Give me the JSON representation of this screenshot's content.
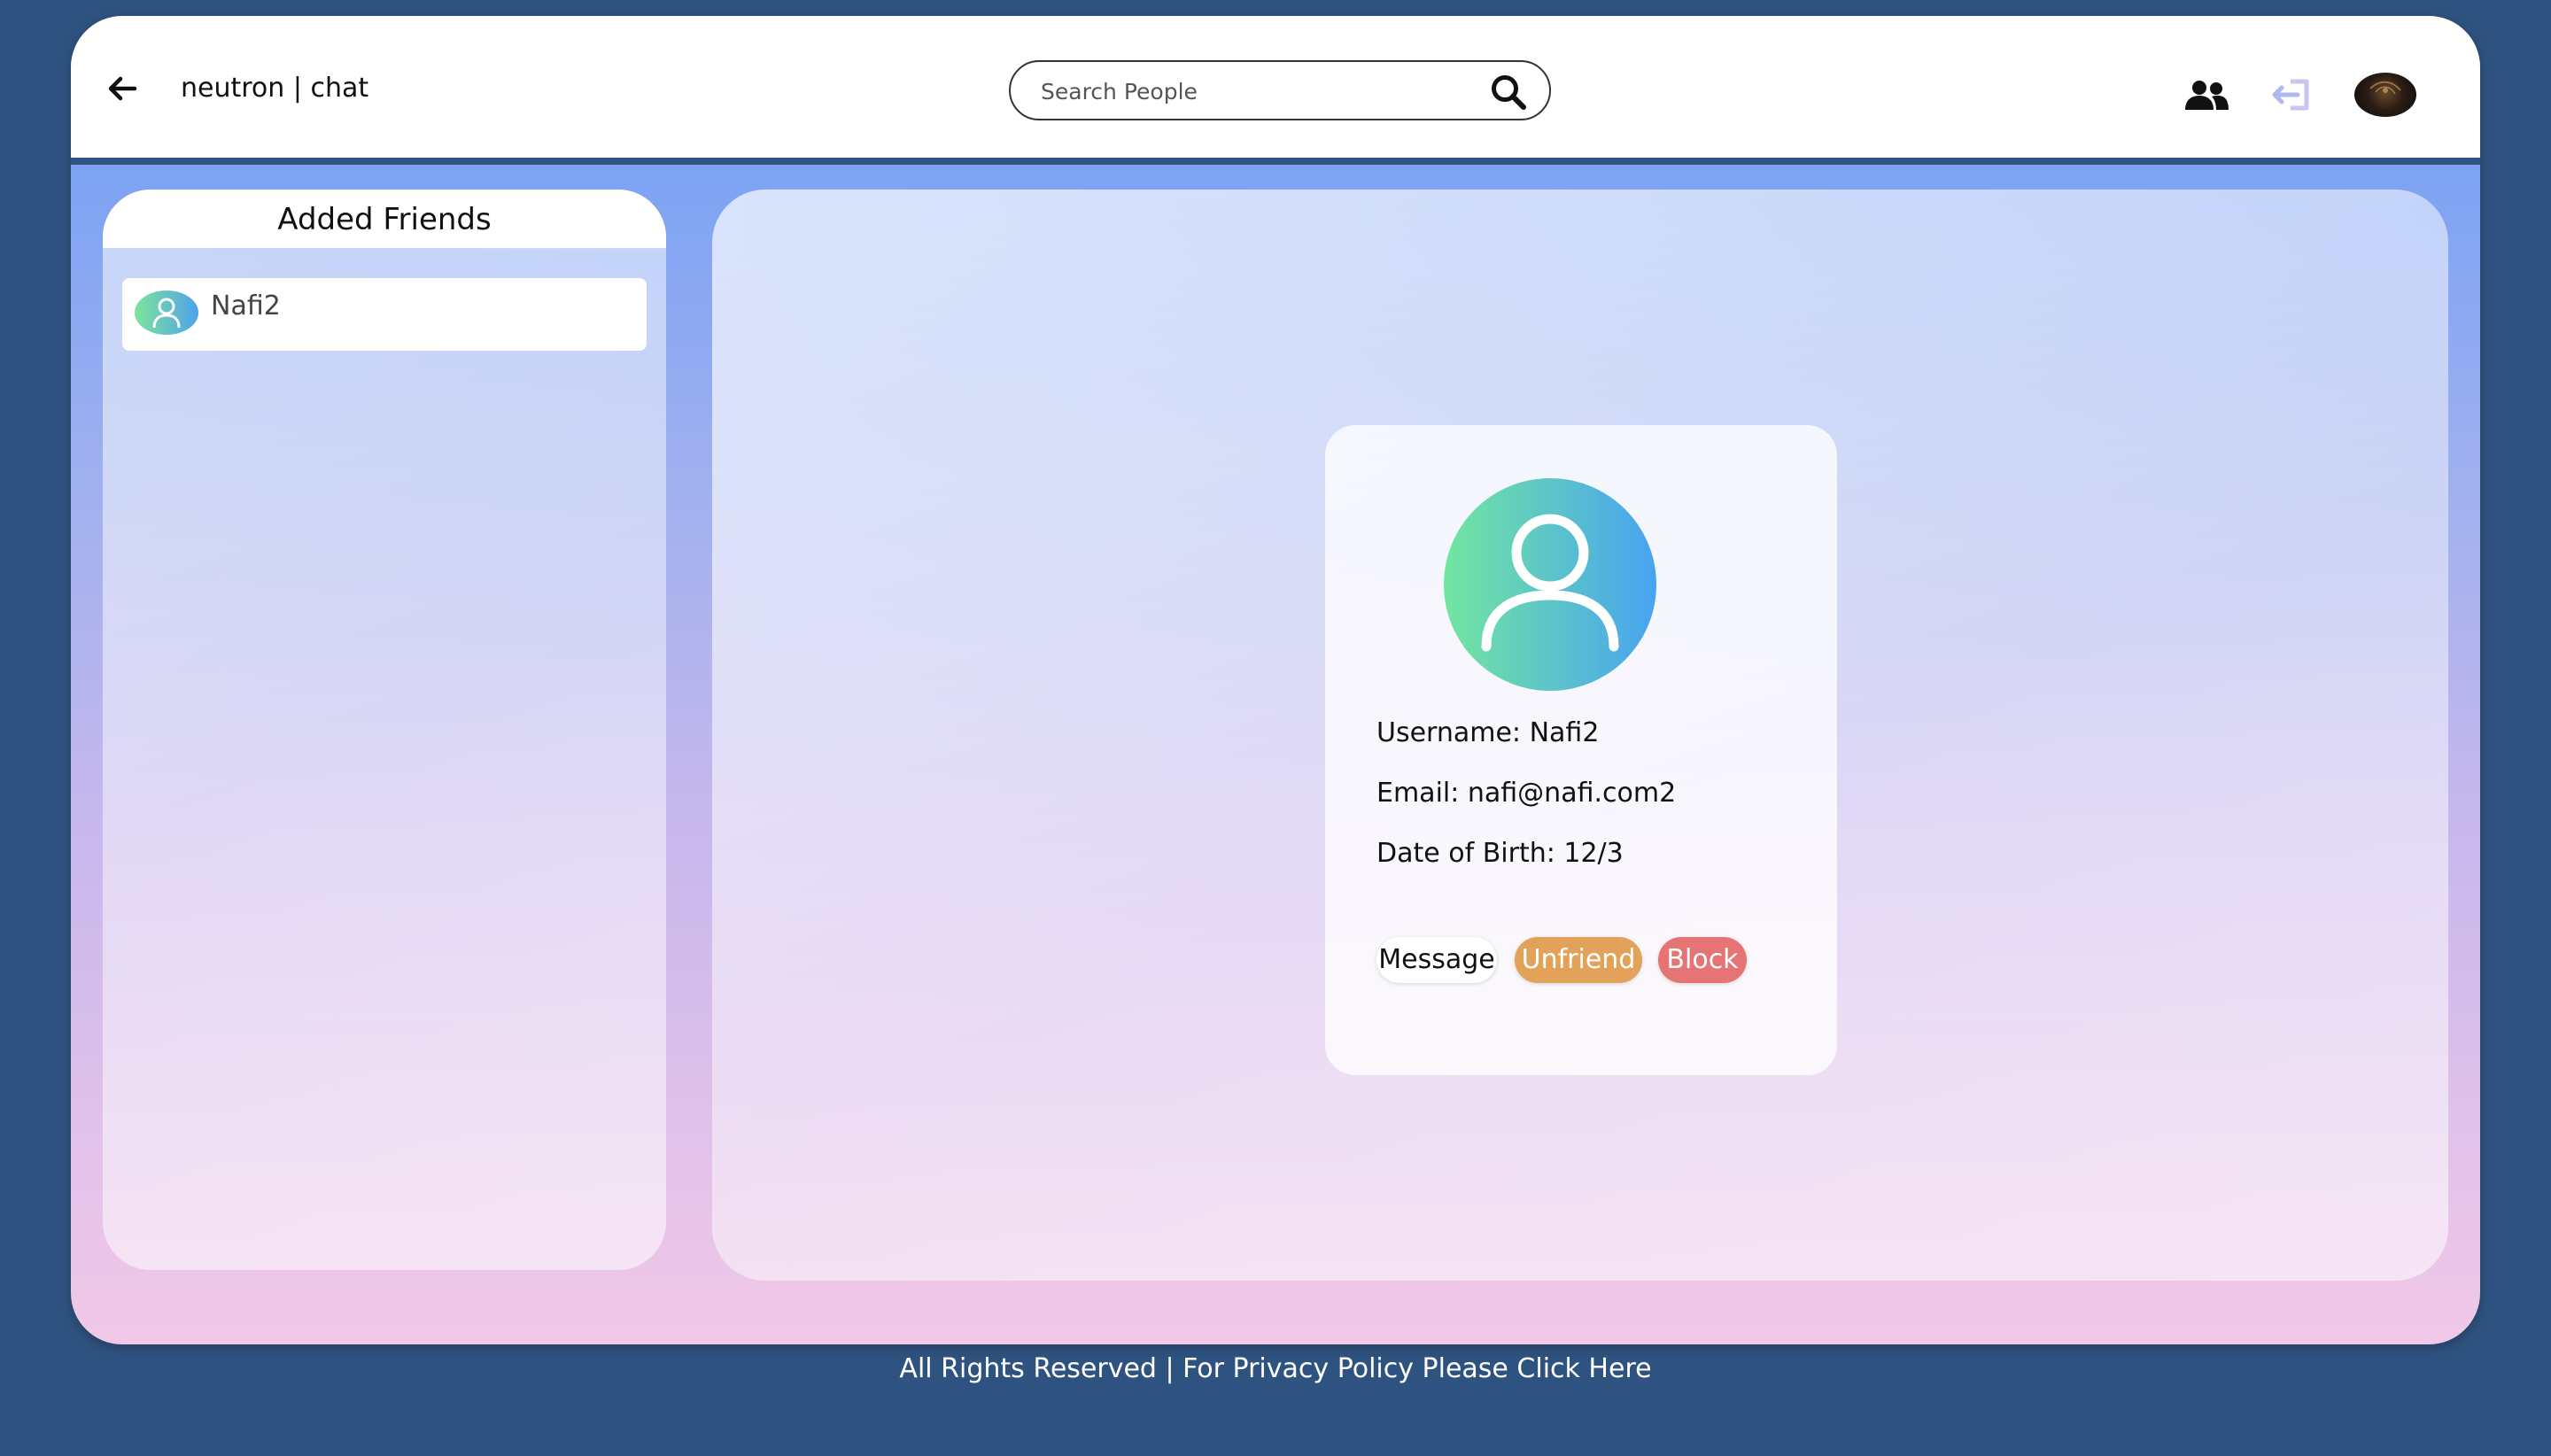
{
  "header": {
    "brand": "neutron | chat",
    "search_placeholder": "Search People",
    "icons": {
      "back": "arrow-left-icon",
      "search": "search-icon",
      "friends": "friends-icon",
      "logout": "logout-icon",
      "avatar": "user-avatar"
    }
  },
  "sidebar": {
    "title": "Added Friends",
    "friends": [
      {
        "name": "Nafi2"
      }
    ]
  },
  "profile": {
    "username_label": "Username:",
    "username": "Nafi2",
    "email_label": "Email:",
    "email": "nafi@nafi.com2",
    "dob_label": "Date of Birth:",
    "dob": "12/3",
    "buttons": {
      "message": "Message",
      "unfriend": "Unfriend",
      "block": "Block"
    }
  },
  "footer": {
    "text": "All Rights Reserved | For Privacy Policy Please Click Here"
  },
  "colors": {
    "page_background": "#2f5380",
    "unfriend_button": "#e3a25a",
    "block_button": "#e77474",
    "avatar_gradient_start": "#72e6a0",
    "avatar_gradient_end": "#48a3f0"
  }
}
